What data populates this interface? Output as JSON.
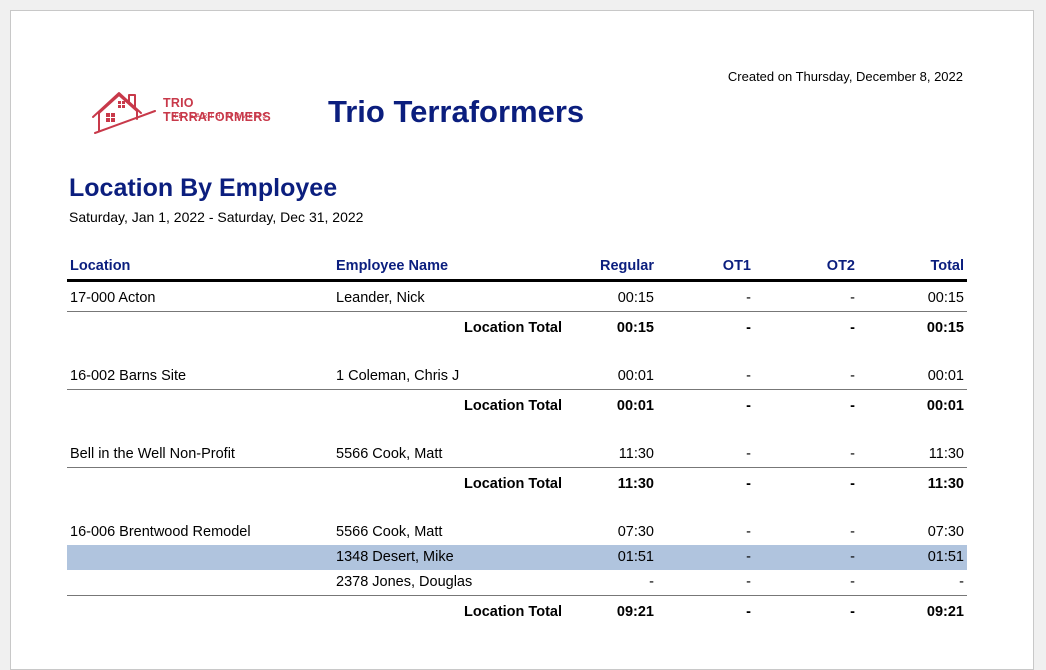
{
  "header": {
    "created": "Created on Thursday, December 8, 2022",
    "company": "Trio Terraformers",
    "logo_name": "TRIO TERRAFORMERS",
    "logo_tagline": "THE EARTH MOVERS",
    "report_title": "Location By Employee",
    "date_range": "Saturday, Jan 1, 2022 - Saturday, Dec 31, 2022"
  },
  "columns": {
    "location": "Location",
    "employee": "Employee Name",
    "regular": "Regular",
    "ot1": "OT1",
    "ot2": "OT2",
    "total": "Total"
  },
  "total_label": "Location Total",
  "groups": [
    {
      "location": "17-000  Acton",
      "rows": [
        {
          "employee": "Leander, Nick",
          "regular": "00:15",
          "ot1": "-",
          "ot2": "-",
          "total": "00:15"
        }
      ],
      "totals": {
        "regular": "00:15",
        "ot1": "-",
        "ot2": "-",
        "total": "00:15"
      }
    },
    {
      "location": "16-002  Barns Site",
      "rows": [
        {
          "employee": "1  Coleman, Chris J",
          "regular": "00:01",
          "ot1": "-",
          "ot2": "-",
          "total": "00:01"
        }
      ],
      "totals": {
        "regular": "00:01",
        "ot1": "-",
        "ot2": "-",
        "total": "00:01"
      }
    },
    {
      "location": "Bell in the Well Non-Profit",
      "rows": [
        {
          "employee": "5566  Cook, Matt",
          "regular": "11:30",
          "ot1": "-",
          "ot2": "-",
          "total": "11:30"
        }
      ],
      "totals": {
        "regular": "11:30",
        "ot1": "-",
        "ot2": "-",
        "total": "11:30"
      }
    },
    {
      "location": "16-006  Brentwood Remodel",
      "rows": [
        {
          "employee": "5566  Cook, Matt",
          "regular": "07:30",
          "ot1": "-",
          "ot2": "-",
          "total": "07:30"
        },
        {
          "employee": "1348  Desert, Mike",
          "regular": "01:51",
          "ot1": "-",
          "ot2": "-",
          "total": "01:51",
          "highlighted": true
        },
        {
          "employee": "2378  Jones, Douglas",
          "regular": "-",
          "ot1": "-",
          "ot2": "-",
          "total": "-"
        }
      ],
      "totals": {
        "regular": "09:21",
        "ot1": "-",
        "ot2": "-",
        "total": "09:21"
      }
    }
  ],
  "colors": {
    "title": "#0b1e7e",
    "logo": "#c8394a",
    "highlight_row": "#b0c4de"
  }
}
